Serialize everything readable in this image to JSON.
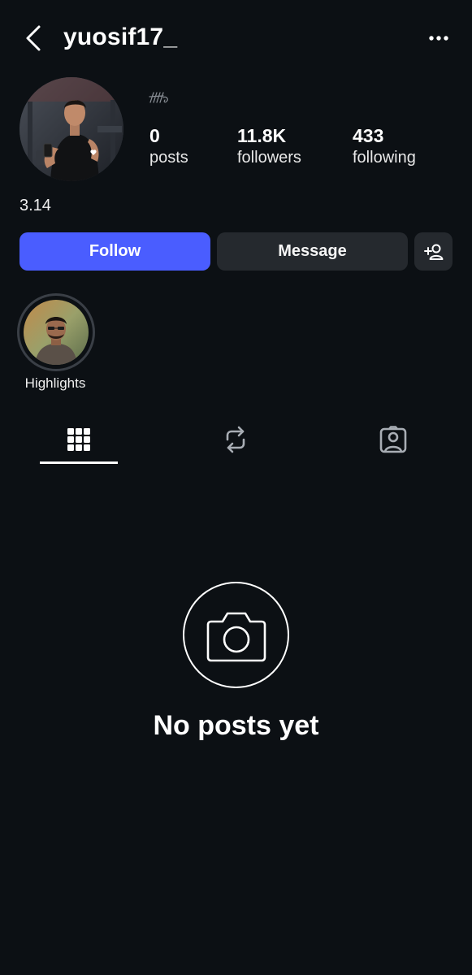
{
  "header": {
    "username": "yuosif17_",
    "back_icon": "chevron-left-icon",
    "more_icon": "more-horizontal-icon"
  },
  "profile": {
    "avatar_icon": "profile-avatar",
    "signature_icon": "signature-scribble-icon",
    "stats": [
      {
        "value": "0",
        "label": "posts"
      },
      {
        "value": "11.8K",
        "label": "followers"
      },
      {
        "value": "433",
        "label": "following"
      }
    ],
    "bio": "3.14"
  },
  "actions": {
    "follow_label": "Follow",
    "message_label": "Message",
    "add_user_icon": "add-user-icon"
  },
  "highlights": [
    {
      "label": "Highlights"
    }
  ],
  "tabs": [
    {
      "icon": "grid-icon",
      "active": true
    },
    {
      "icon": "repost-icon",
      "active": false
    },
    {
      "icon": "tagged-icon",
      "active": false
    }
  ],
  "empty_state": {
    "icon": "camera-icon",
    "title": "No posts yet"
  },
  "colors": {
    "background": "#0c1014",
    "follow_button": "#4a5dff",
    "secondary_button": "#25292e"
  }
}
